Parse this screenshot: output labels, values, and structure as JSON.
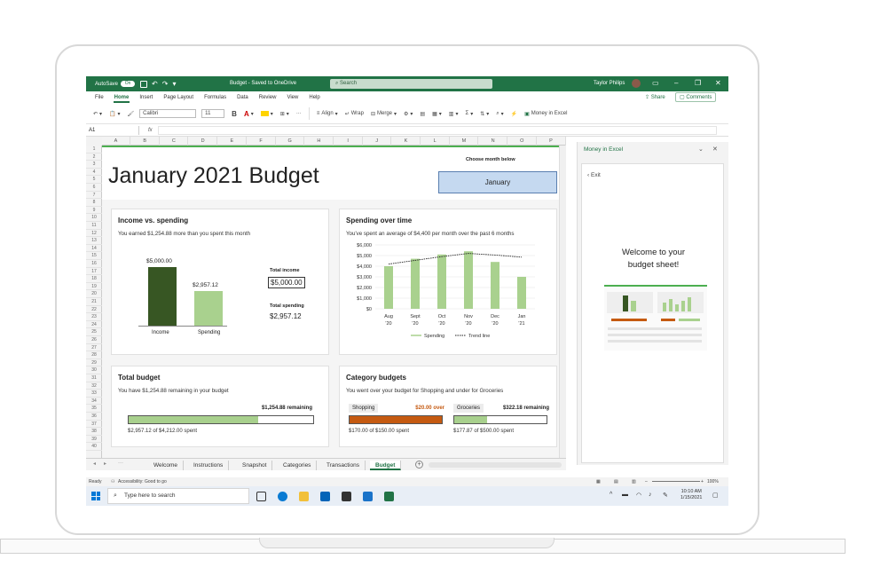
{
  "titlebar": {
    "autosave_label": "AutoSave",
    "autosave_state": "On",
    "doc_title": "Budget - Saved to OneDrive",
    "search_placeholder": "Search",
    "user_name": "Taylor Philips",
    "accent_color": "#217346"
  },
  "menu": {
    "items": [
      "File",
      "Home",
      "Insert",
      "Page Layout",
      "Formulas",
      "Data",
      "Review",
      "View",
      "Help"
    ],
    "active": "Home",
    "share_label": "Share",
    "comments_label": "Comments"
  },
  "ribbon": {
    "font_name": "Calibri",
    "font_size": "11",
    "bold_label": "B",
    "font_color_label": "A",
    "align_label": "Align",
    "wrap_label": "Wrap",
    "merge_label": "Merge",
    "money_label": "Money in Excel",
    "more_label": "···"
  },
  "formula_bar": {
    "cell_ref": "A1",
    "fx_label": "fx"
  },
  "grid": {
    "columns": [
      "A",
      "B",
      "C",
      "D",
      "E",
      "F",
      "G",
      "H",
      "I",
      "J",
      "K",
      "L",
      "M",
      "N",
      "O",
      "P"
    ],
    "rows": [
      "1",
      "2",
      "3",
      "4",
      "5",
      "6",
      "7",
      "8",
      "9",
      "10",
      "11",
      "12",
      "13",
      "14",
      "15",
      "16",
      "17",
      "18",
      "19",
      "20",
      "21",
      "22",
      "23",
      "24",
      "25",
      "26",
      "27",
      "28",
      "29",
      "30",
      "31",
      "32",
      "33",
      "34",
      "35",
      "36",
      "37",
      "38",
      "39",
      "40"
    ]
  },
  "sheet": {
    "title": "January 2021 Budget",
    "choose_label": "Choose month below",
    "selected_month": "January"
  },
  "income_card": {
    "title": "Income vs. spending",
    "subtitle": "You earned $1,254.88 more than you spent this month",
    "total_income_label": "Total income",
    "total_income_value": "$5,000.00",
    "total_spending_label": "Total spending",
    "total_spending_value": "$2,957.12"
  },
  "spending_card": {
    "title": "Spending over time",
    "subtitle": "You've spent an average of $4,400 per month over the past 6 months"
  },
  "total_budget_card": {
    "title": "Total budget",
    "subtitle": "You have $1,254.88 remaining in your budget",
    "remaining_label": "$1,254.88 remaining",
    "spent_caption": "$2,957.12 of $4,212.00 spent",
    "progress_fraction": 0.702
  },
  "category_card": {
    "title": "Category budgets",
    "subtitle": "You went over your budget for Shopping and under for Groceries",
    "categories": [
      {
        "name": "Shopping",
        "status": "$20.00 over",
        "caption": "$170.00 of $150.00 spent",
        "fraction": 1.0,
        "color": "#c55a11",
        "status_color": "#c55a11"
      },
      {
        "name": "Groceries",
        "status": "$322.18 remaining",
        "caption": "$177.87 of $500.00 spent",
        "fraction": 0.356,
        "color": "#a8d08d",
        "status_color": "#222222"
      }
    ]
  },
  "chart_data": [
    {
      "type": "bar",
      "title": "Income vs. spending",
      "categories": [
        "Income",
        "Spending"
      ],
      "values": [
        5000.0,
        2957.12
      ],
      "value_labels": [
        "$5,000.00",
        "$2,957.12"
      ],
      "colors": [
        "#375623",
        "#a9d18e"
      ],
      "ylim": [
        0,
        5000
      ]
    },
    {
      "type": "bar",
      "title": "Spending over time",
      "categories": [
        "Aug '20",
        "Sept '20",
        "Oct '20",
        "Nov '20",
        "Dec '20",
        "Jan '21"
      ],
      "x_labels_top": [
        "Aug",
        "Sept",
        "Oct",
        "Nov",
        "Dec",
        "Jan"
      ],
      "x_labels_bottom": [
        "'20",
        "'20",
        "'20",
        "'20",
        "'20",
        "'21"
      ],
      "series": [
        {
          "name": "Spending",
          "values": [
            4000,
            4700,
            5100,
            5400,
            4400,
            3000
          ],
          "color": "#a9d18e"
        },
        {
          "name": "Trend line",
          "values": [
            4200,
            4550,
            4900,
            5200,
            5050,
            4850
          ],
          "color": "#222222",
          "style": "dotted"
        }
      ],
      "y_ticks": [
        "$0",
        "$1,000",
        "$2,000",
        "$3,000",
        "$4,000",
        "$5,000",
        "$6,000"
      ],
      "ylim": [
        0,
        6000
      ],
      "legend_position": "bottom",
      "grid": true
    }
  ],
  "tabs": {
    "items": [
      "Welcome",
      "Instructions",
      "Snapshot",
      "Categories",
      "Transactions",
      "Budget"
    ],
    "active": "Budget"
  },
  "status": {
    "ready": "Ready",
    "accessibility": "Accessibility: Good to go",
    "zoom": "100%"
  },
  "taskbar": {
    "search_placeholder": "Type here to search",
    "time": "10:10 AM",
    "date": "1/15/2021"
  },
  "pane": {
    "title": "Money in Excel",
    "exit_label": "Exit",
    "welcome_line1": "Welcome to your",
    "welcome_line2": "budget sheet!"
  }
}
